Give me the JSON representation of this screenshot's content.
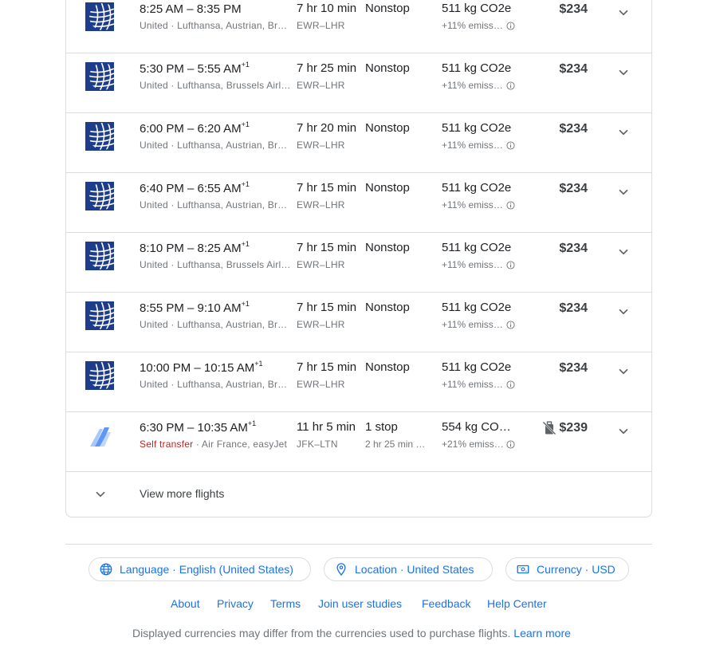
{
  "flights": [
    {
      "times": "8:25 AM – 8:35 PM",
      "plus": "",
      "airline": "United · Lufthansa, Austrian, Br…",
      "self_transfer": "",
      "duration": "7 hr 10 min",
      "route": "EWR–LHR",
      "stops": "Nonstop",
      "layover": "",
      "co2": "511 kg CO2e",
      "emissions": "+11% emissi…",
      "price": "$234",
      "logo": "united-globe-logo",
      "bag_icon": false
    },
    {
      "times": "5:30 PM – 5:55 AM",
      "plus": "+1",
      "airline": "United · Lufthansa, Brussels Airl…",
      "self_transfer": "",
      "duration": "7 hr 25 min",
      "route": "EWR–LHR",
      "stops": "Nonstop",
      "layover": "",
      "co2": "511 kg CO2e",
      "emissions": "+11% emissi…",
      "price": "$234",
      "logo": "united-globe-logo",
      "bag_icon": false
    },
    {
      "times": "6:00 PM – 6:20 AM",
      "plus": "+1",
      "airline": "United · Lufthansa, Austrian, Br…",
      "self_transfer": "",
      "duration": "7 hr 20 min",
      "route": "EWR–LHR",
      "stops": "Nonstop",
      "layover": "",
      "co2": "511 kg CO2e",
      "emissions": "+11% emissi…",
      "price": "$234",
      "logo": "united-globe-logo",
      "bag_icon": false
    },
    {
      "times": "6:40 PM – 6:55 AM",
      "plus": "+1",
      "airline": "United · Lufthansa, Austrian, Br…",
      "self_transfer": "",
      "duration": "7 hr 15 min",
      "route": "EWR–LHR",
      "stops": "Nonstop",
      "layover": "",
      "co2": "511 kg CO2e",
      "emissions": "+11% emissi…",
      "price": "$234",
      "logo": "united-globe-logo",
      "bag_icon": false
    },
    {
      "times": "8:10 PM – 8:25 AM",
      "plus": "+1",
      "airline": "United · Lufthansa, Brussels Airl…",
      "self_transfer": "",
      "duration": "7 hr 15 min",
      "route": "EWR–LHR",
      "stops": "Nonstop",
      "layover": "",
      "co2": "511 kg CO2e",
      "emissions": "+11% emissi…",
      "price": "$234",
      "logo": "united-globe-logo",
      "bag_icon": false
    },
    {
      "times": "8:55 PM – 9:10 AM",
      "plus": "+1",
      "airline": "United · Lufthansa, Austrian, Br…",
      "self_transfer": "",
      "duration": "7 hr 15 min",
      "route": "EWR–LHR",
      "stops": "Nonstop",
      "layover": "",
      "co2": "511 kg CO2e",
      "emissions": "+11% emissi…",
      "price": "$234",
      "logo": "united-globe-logo",
      "bag_icon": false
    },
    {
      "times": "10:00 PM – 10:15 AM",
      "plus": "+1",
      "airline": "United · Lufthansa, Austrian, Br…",
      "self_transfer": "",
      "duration": "7 hr 15 min",
      "route": "EWR–LHR",
      "stops": "Nonstop",
      "layover": "",
      "co2": "511 kg CO2e",
      "emissions": "+11% emissi…",
      "price": "$234",
      "logo": "united-globe-logo",
      "bag_icon": false
    },
    {
      "times": "6:30 PM – 10:35 AM",
      "plus": "+1",
      "airline": "Air France, easyJet",
      "self_transfer": "Self transfer",
      "duration": "11 hr 5 min",
      "route": "JFK–LTN",
      "stops": "1 stop",
      "layover": "2 hr 25 min C…",
      "co2": "554 kg CO…",
      "emissions": "+21% emissi…",
      "price": "$239",
      "logo": "multi-airline-logo",
      "bag_icon": true
    }
  ],
  "view_more": "View more flights",
  "chips": {
    "language": "Language · English (United States)",
    "location": "Location · United States",
    "currency": "Currency · USD"
  },
  "footer_links": [
    "About",
    "Privacy",
    "Terms",
    "Join user studies",
    "Feedback",
    "Help Center"
  ],
  "disclaimer": {
    "text": "Displayed currencies may differ from the currencies used to purchase flights.",
    "link": "Learn more"
  },
  "colors": {
    "accent": "#1a73e8",
    "self_transfer": "#c5221f",
    "united_blue": "#1d3c8c"
  }
}
